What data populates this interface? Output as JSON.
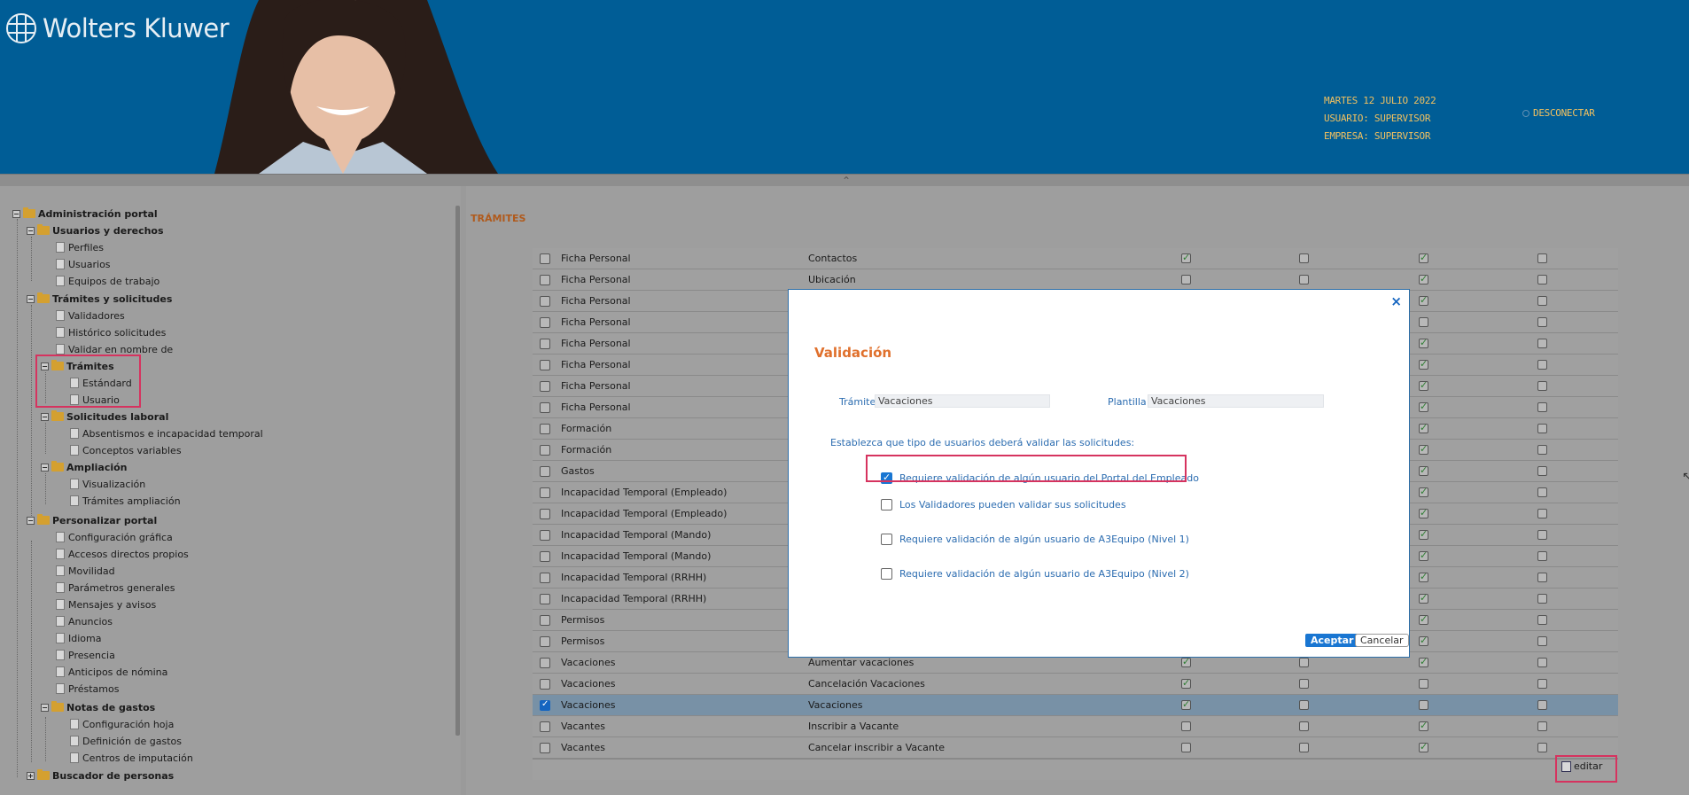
{
  "header": {
    "brand": "Wolters Kluwer",
    "date": "MARTES 12 JULIO 2022",
    "user_label": "USUARIO:",
    "user_value": "SUPERVISOR",
    "company_label": "EMPRESA:",
    "company_value": "SUPERVISOR",
    "disconnect": "DESCONECTAR"
  },
  "tree": {
    "root": "Administración portal",
    "usuarios_derechos": "Usuarios y derechos",
    "perfiles": "Perfiles",
    "usuarios": "Usuarios",
    "equipos": "Equipos de trabajo",
    "tramites_solicitudes": "Trámites y solicitudes",
    "validadores": "Validadores",
    "historico": "Histórico solicitudes",
    "validar_nombre": "Validar en nombre de",
    "tramites": "Trámites",
    "estandard": "Estándard",
    "usuario": "Usuario",
    "solicitudes_laboral": "Solicitudes laboral",
    "absentismos": "Absentismos e incapacidad temporal",
    "conceptos": "Conceptos variables",
    "ampliacion": "Ampliación",
    "visualizacion": "Visualización",
    "tramites_ampliacion": "Trámites ampliación",
    "personalizar": "Personalizar portal",
    "config_grafica": "Configuración gráfica",
    "accesos": "Accesos directos propios",
    "movilidad": "Movilidad",
    "parametros": "Parámetros generales",
    "mensajes": "Mensajes y avisos",
    "anuncios": "Anuncios",
    "idioma": "Idioma",
    "presencia": "Presencia",
    "anticipos": "Anticipos de nómina",
    "prestamos": "Préstamos",
    "notas_gastos": "Notas de gastos",
    "config_hoja": "Configuración hoja",
    "definicion_gastos": "Definición de gastos",
    "centros": "Centros de imputación",
    "buscador": "Buscador de personas"
  },
  "content": {
    "title": "TRÁMITES",
    "edit_label": "editar",
    "rows": [
      {
        "c1": "Ficha Personal",
        "c2": "Contactos",
        "b": [
          1,
          0,
          1,
          0
        ]
      },
      {
        "c1": "Ficha Personal",
        "c2": "Ubicación",
        "b": [
          0,
          0,
          1,
          0
        ]
      },
      {
        "c1": "Ficha Personal",
        "c2": "",
        "b": [
          0,
          0,
          1,
          0
        ]
      },
      {
        "c1": "Ficha Personal",
        "c2": "",
        "b": [
          0,
          0,
          0,
          0
        ]
      },
      {
        "c1": "Ficha Personal",
        "c2": "",
        "b": [
          0,
          0,
          1,
          0
        ]
      },
      {
        "c1": "Ficha Personal",
        "c2": "",
        "b": [
          0,
          0,
          1,
          0
        ]
      },
      {
        "c1": "Ficha Personal",
        "c2": "",
        "b": [
          0,
          0,
          1,
          0
        ]
      },
      {
        "c1": "Ficha Personal",
        "c2": "",
        "b": [
          0,
          0,
          1,
          0
        ]
      },
      {
        "c1": "Formación",
        "c2": "",
        "b": [
          0,
          0,
          1,
          0
        ]
      },
      {
        "c1": "Formación",
        "c2": "",
        "b": [
          0,
          0,
          1,
          0
        ]
      },
      {
        "c1": "Gastos",
        "c2": "",
        "b": [
          0,
          0,
          1,
          0
        ]
      },
      {
        "c1": "Incapacidad Temporal (Empleado)",
        "c2": "",
        "b": [
          0,
          0,
          1,
          0
        ]
      },
      {
        "c1": "Incapacidad Temporal (Empleado)",
        "c2": "",
        "b": [
          0,
          0,
          1,
          0
        ]
      },
      {
        "c1": "Incapacidad Temporal (Mando)",
        "c2": "",
        "b": [
          0,
          0,
          1,
          0
        ]
      },
      {
        "c1": "Incapacidad Temporal (Mando)",
        "c2": "",
        "b": [
          0,
          0,
          1,
          0
        ]
      },
      {
        "c1": "Incapacidad Temporal (RRHH)",
        "c2": "",
        "b": [
          0,
          0,
          1,
          0
        ]
      },
      {
        "c1": "Incapacidad Temporal (RRHH)",
        "c2": "",
        "b": [
          0,
          0,
          1,
          0
        ]
      },
      {
        "c1": "Permisos",
        "c2": "",
        "b": [
          0,
          0,
          1,
          0
        ]
      },
      {
        "c1": "Permisos",
        "c2": "",
        "b": [
          0,
          0,
          1,
          0
        ]
      },
      {
        "c1": "Vacaciones",
        "c2": "Aumentar vacaciones",
        "b": [
          1,
          0,
          1,
          0
        ]
      },
      {
        "c1": "Vacaciones",
        "c2": "Cancelación Vacaciones",
        "b": [
          1,
          0,
          0,
          0
        ]
      },
      {
        "c1": "Vacaciones",
        "c2": "Vacaciones",
        "b": [
          1,
          0,
          0,
          0
        ],
        "selected": true
      },
      {
        "c1": "Vacantes",
        "c2": "Inscribir a Vacante",
        "b": [
          0,
          0,
          1,
          0
        ]
      },
      {
        "c1": "Vacantes",
        "c2": "Cancelar inscribir a Vacante",
        "b": [
          0,
          0,
          1,
          0
        ]
      }
    ]
  },
  "modal": {
    "title": "Validación",
    "tramite_label": "Trámite",
    "tramite_value": "Vacaciones",
    "plantilla_label": "Plantilla",
    "plantilla_value": "Vacaciones",
    "instructions": "Establezca que tipo de usuarios deberá validar las solicitudes:",
    "options": [
      {
        "label": "Requiere validación de algún usuario del Portal del Empleado",
        "checked": true
      },
      {
        "label": "Los Validadores pueden validar sus solicitudes",
        "checked": false
      },
      {
        "label": "Requiere validación de algún usuario de A3Equipo (Nivel 1)",
        "checked": false
      },
      {
        "label": "Requiere validación de algún usuario de A3Equipo (Nivel 2)",
        "checked": false
      }
    ],
    "accept": "Aceptar",
    "cancel": "Cancelar",
    "close_icon": "×"
  },
  "colors": {
    "header_bg": "#005d96",
    "accent_orange": "#e0702c",
    "link_blue": "#2b6cb0",
    "highlight_red": "#d6335f"
  }
}
